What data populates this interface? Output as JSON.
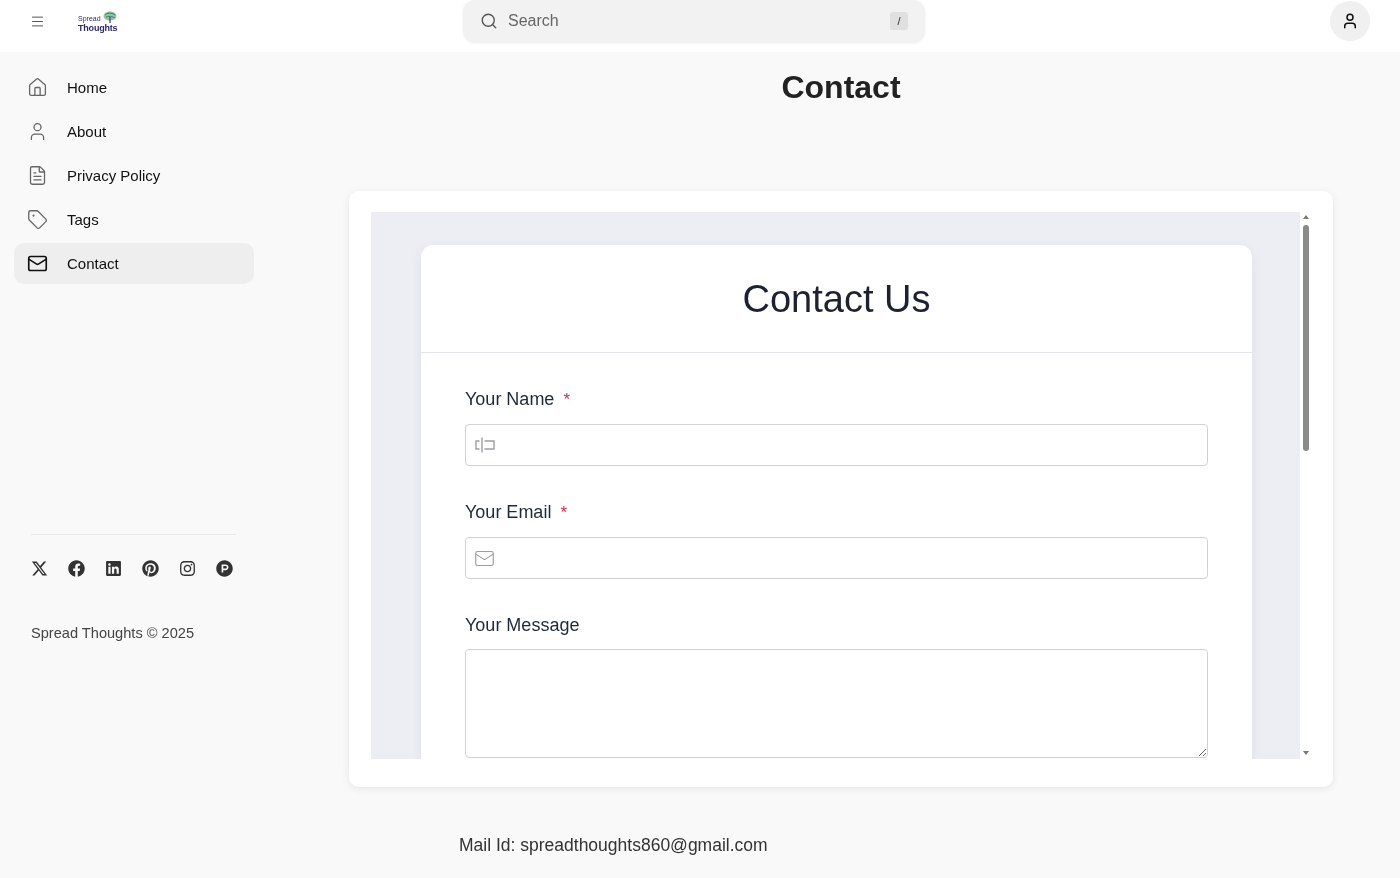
{
  "header": {
    "logo": {
      "small_text": "Spread",
      "text": "Thoughts"
    },
    "search": {
      "placeholder": "Search",
      "shortcut": "/"
    }
  },
  "sidebar": {
    "items": [
      {
        "label": "Home",
        "selected": false
      },
      {
        "label": "About",
        "selected": false
      },
      {
        "label": "Privacy Policy",
        "selected": false
      },
      {
        "label": "Tags",
        "selected": false
      },
      {
        "label": "Contact",
        "selected": true
      }
    ],
    "copyright": "Spread Thoughts © 2025"
  },
  "page": {
    "title": "Contact",
    "form": {
      "title": "Contact Us",
      "fields": [
        {
          "kind": "text",
          "label": "Your Name",
          "required_mark": "*"
        },
        {
          "kind": "email",
          "label": "Your Email",
          "required_mark": "*"
        },
        {
          "kind": "textarea",
          "label": "Your Message"
        }
      ]
    },
    "mail_note": "Mail Id: spreadthoughts860@gmail.com"
  }
}
